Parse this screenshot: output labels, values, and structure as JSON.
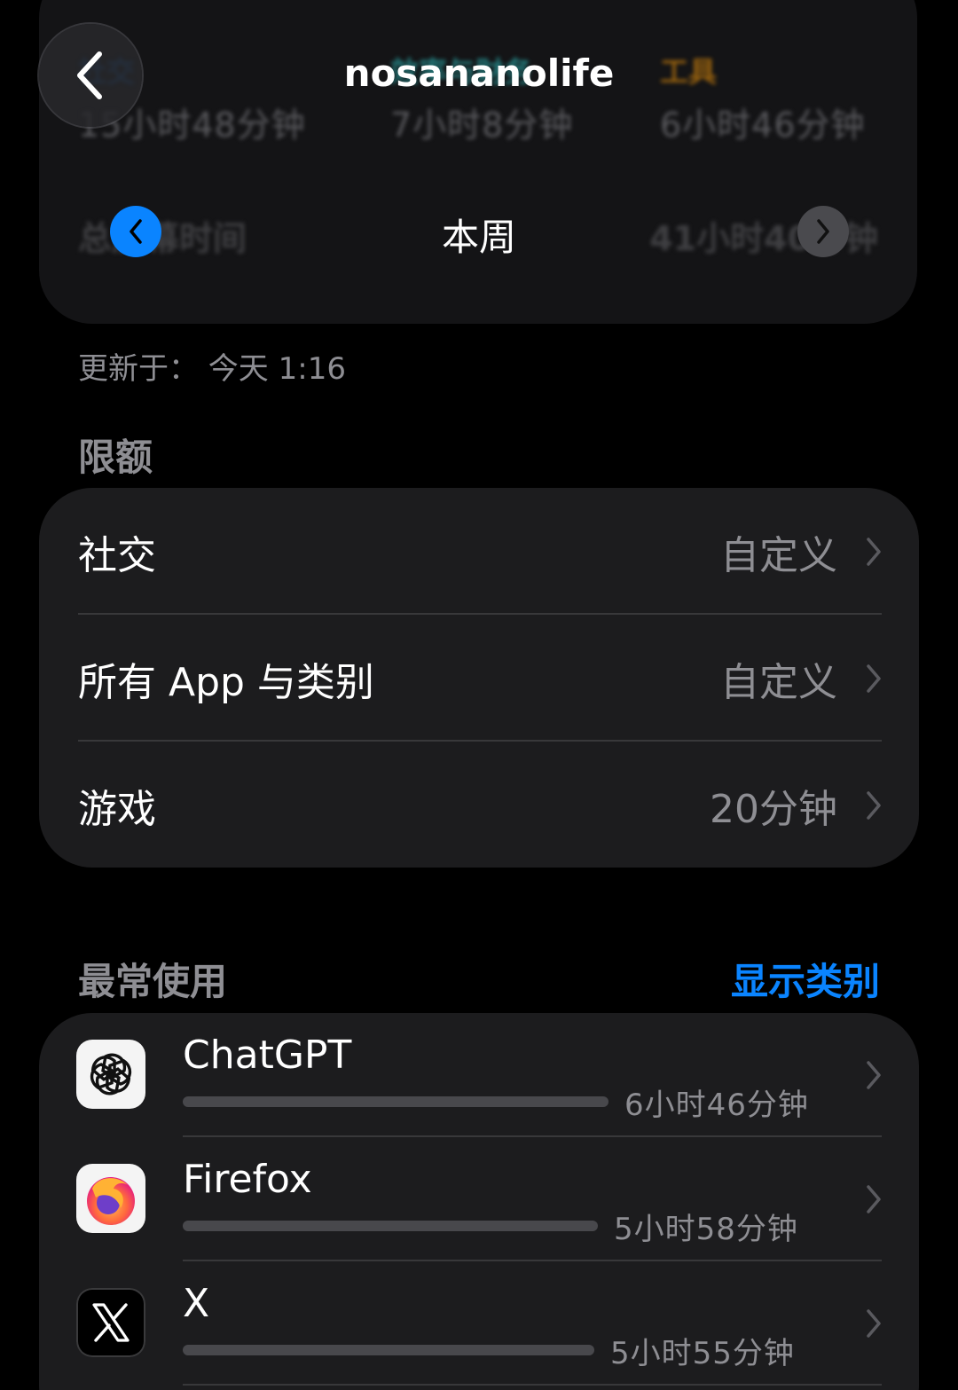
{
  "summary": {
    "categories": [
      {
        "label": "社交",
        "time": "15小时48分钟",
        "color": "#0a84ff"
      },
      {
        "label": "效率与财务",
        "time": "7小时8分钟",
        "color": "#30c8c8"
      },
      {
        "label": "工具",
        "time": "6小时46分钟",
        "color": "#ff9f0a"
      }
    ],
    "total_label": "总屏幕时间",
    "total_value": "41小时40分钟"
  },
  "header": {
    "title": "nosananolife",
    "back_icon": "chevron-left-icon"
  },
  "week": {
    "label": "本周",
    "prev_icon": "chevron-left-icon",
    "next_icon": "chevron-right-icon"
  },
  "updated": "更新于：  今天 1:16",
  "limits": {
    "title": "限额",
    "items": [
      {
        "label": "社交",
        "value": "自定义"
      },
      {
        "label": "所有 App 与类别",
        "value": "自定义"
      },
      {
        "label": "游戏",
        "value": "20分钟"
      }
    ]
  },
  "most_used": {
    "title": "最常使用",
    "link": "显示类别",
    "apps": [
      {
        "name": "ChatGPT",
        "time": "6小时46分钟",
        "icon": "chatgpt-icon",
        "usage_fraction": 1.0
      },
      {
        "name": "Firefox",
        "time": "5小时58分钟",
        "icon": "firefox-icon",
        "usage_fraction": 0.98
      },
      {
        "name": "X",
        "time": "5小时55分钟",
        "icon": "x-icon",
        "usage_fraction": 0.97
      }
    ]
  },
  "colors": {
    "accent": "#0a84ff",
    "card": "#1c1c1e",
    "separator": "#38383a",
    "secondary_text": "#8e8e93"
  }
}
